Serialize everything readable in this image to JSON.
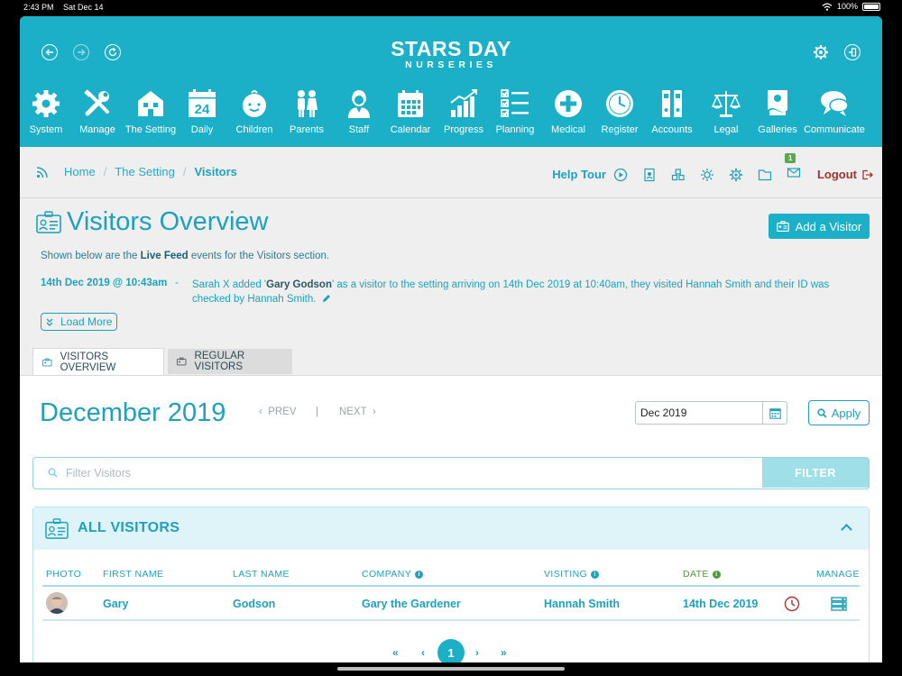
{
  "status": {
    "time": "2:43 PM",
    "date": "Sat Dec 14",
    "battery": "100%"
  },
  "brand": {
    "line1": "STARS DAY",
    "line2": "NURSERIES"
  },
  "nav": [
    {
      "label": "System",
      "icon": "gear-icon"
    },
    {
      "label": "Manage",
      "icon": "tools-icon"
    },
    {
      "label": "The Setting",
      "icon": "building-icon"
    },
    {
      "label": "Daily",
      "icon": "daily-calendar-icon"
    },
    {
      "label": "Children",
      "icon": "child-face-icon"
    },
    {
      "label": "Parents",
      "icon": "parents-icon"
    },
    {
      "label": "Staff",
      "icon": "staff-icon"
    },
    {
      "label": "Calendar",
      "icon": "calendar-icon"
    },
    {
      "label": "Progress",
      "icon": "progress-chart-icon"
    },
    {
      "label": "Planning",
      "icon": "checklist-icon"
    },
    {
      "label": "Medical",
      "icon": "medical-cross-icon"
    },
    {
      "label": "Register",
      "icon": "clock-icon"
    },
    {
      "label": "Accounts",
      "icon": "binders-icon"
    },
    {
      "label": "Legal",
      "icon": "scales-icon"
    },
    {
      "label": "Galleries",
      "icon": "gallery-icon"
    },
    {
      "label": "Communicate",
      "icon": "chat-bubbles-icon"
    }
  ],
  "breadcrumb": {
    "home": "Home",
    "setting": "The Setting",
    "current": "Visitors"
  },
  "toolbar": {
    "help": "Help Tour",
    "badge": "1",
    "logout": "Logout"
  },
  "overview": {
    "title": "Visitors Overview",
    "add_button": "Add a Visitor",
    "intro_prefix": "Shown below are the ",
    "intro_bold": "Live Feed",
    "intro_suffix": " events for the Visitors section.",
    "feed": {
      "when": "14th Dec 2019 @ 10:43am",
      "dash": "-",
      "text_prefix": "Sarah X added '",
      "text_bold": "Gary Godson",
      "text_suffix": "' as a visitor to the setting arriving on 14th Dec 2019 at 10:40am, they visited Hannah Smith and their ID was checked by Hannah Smith."
    },
    "load_more": "Load More"
  },
  "tabs": {
    "overview": "VISITORS OVERVIEW",
    "regular": "REGULAR VISITORS"
  },
  "period": {
    "title": "December 2019",
    "prev": "PREV",
    "sep": "|",
    "next": "NEXT",
    "input_value": "Dec 2019",
    "apply": "Apply"
  },
  "filter": {
    "placeholder": "Filter Visitors",
    "button": "FILTER"
  },
  "visitors": {
    "title": "ALL VISITORS",
    "columns": {
      "photo": "PHOTO",
      "first": "FIRST NAME",
      "last": "LAST NAME",
      "company": "COMPANY",
      "visiting": "VISITING",
      "date": "DATE",
      "manage": "MANAGE"
    },
    "rows": [
      {
        "first": "Gary",
        "last": "Godson",
        "company": "Gary the Gardener",
        "visiting": "Hannah Smith",
        "date": "14th Dec 2019"
      }
    ]
  },
  "pager": {
    "first": "«",
    "prev": "‹",
    "current": "1",
    "next": "›",
    "last": "»"
  },
  "colors": {
    "brand": "#1cb0c8",
    "text_accent": "#1fa1bb",
    "logout": "#a4332e",
    "date_header": "#4d9a3c"
  }
}
